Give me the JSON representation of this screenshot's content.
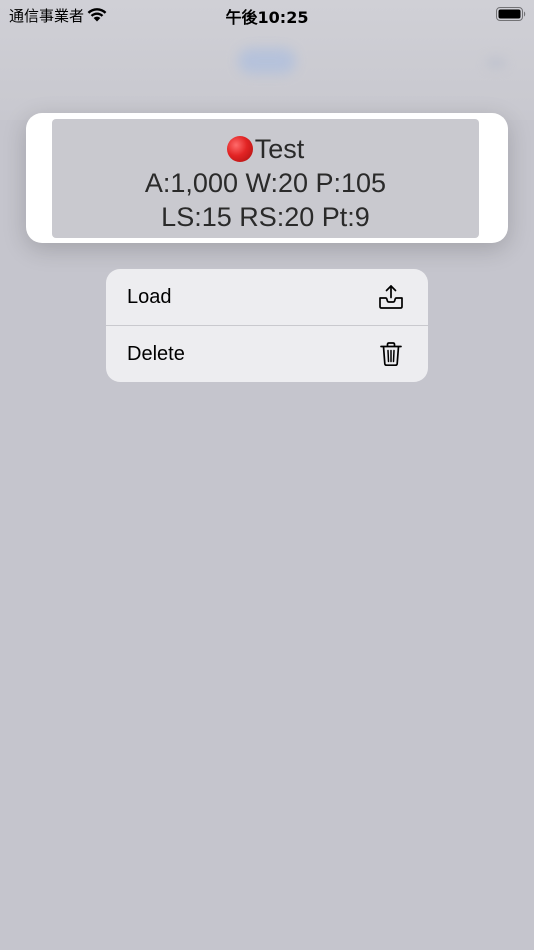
{
  "status_bar": {
    "carrier": "通信事業者",
    "time": "午後10:25",
    "wifi_icon": "wifi-icon",
    "battery_icon": "battery-icon"
  },
  "preview": {
    "title": "Test",
    "title_marker": "red-circle-icon",
    "line2": "A:1,000 W:20 P:105",
    "line3": "LS:15 RS:20 Pt:9"
  },
  "context_menu": {
    "items": [
      {
        "label": "Load",
        "icon": "tray-upload-icon"
      },
      {
        "label": "Delete",
        "icon": "trash-icon"
      }
    ]
  },
  "colors": {
    "backdrop": "#c5c5cd",
    "menu_background": "#ededf0",
    "marker_red": "#e22424"
  }
}
